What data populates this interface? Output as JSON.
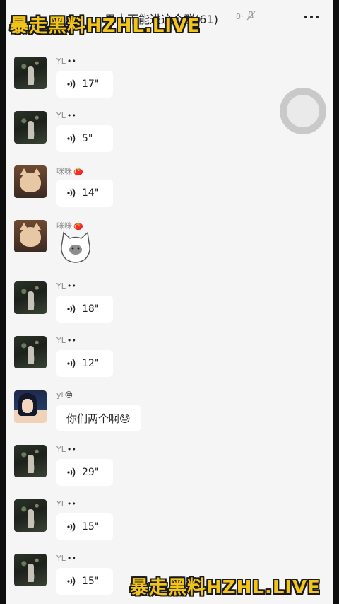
{
  "header": {
    "title": "男人不能进这个群(61)",
    "mute_icon": "mute-bell-icon",
    "more_icon": "ellipsis-icon"
  },
  "watermark": {
    "top": "暴走黑料HZHL.LIVE",
    "bottom": "暴走黑料HZHL.LIVE"
  },
  "messages": [
    {
      "sender": "YL",
      "sender_emoji": "••",
      "type": "voice",
      "duration": "17\""
    },
    {
      "sender": "YL",
      "sender_emoji": "••",
      "type": "voice",
      "duration": "5\""
    },
    {
      "sender": "咪咪",
      "sender_emoji": "🍅",
      "type": "voice",
      "duration": "14\""
    },
    {
      "sender": "咪咪",
      "sender_emoji": "🍅",
      "type": "sticker",
      "sticker_icon": "cat-sticker-icon"
    },
    {
      "sender": "YL",
      "sender_emoji": "••",
      "type": "voice",
      "duration": "18\""
    },
    {
      "sender": "YL",
      "sender_emoji": "••",
      "type": "voice",
      "duration": "12\""
    },
    {
      "sender": "yi",
      "sender_emoji": "😔",
      "type": "text",
      "text": "你们两个啊😓"
    },
    {
      "sender": "YL",
      "sender_emoji": "••",
      "type": "voice",
      "duration": "29\""
    },
    {
      "sender": "YL",
      "sender_emoji": "••",
      "type": "voice",
      "duration": "15\""
    },
    {
      "sender": "YL",
      "sender_emoji": "••",
      "type": "voice",
      "duration": "15\""
    }
  ],
  "colors": {
    "chat_background": "#f5f5f5",
    "bubble": "#ffffff",
    "watermark_yellow": "#f2c318"
  }
}
